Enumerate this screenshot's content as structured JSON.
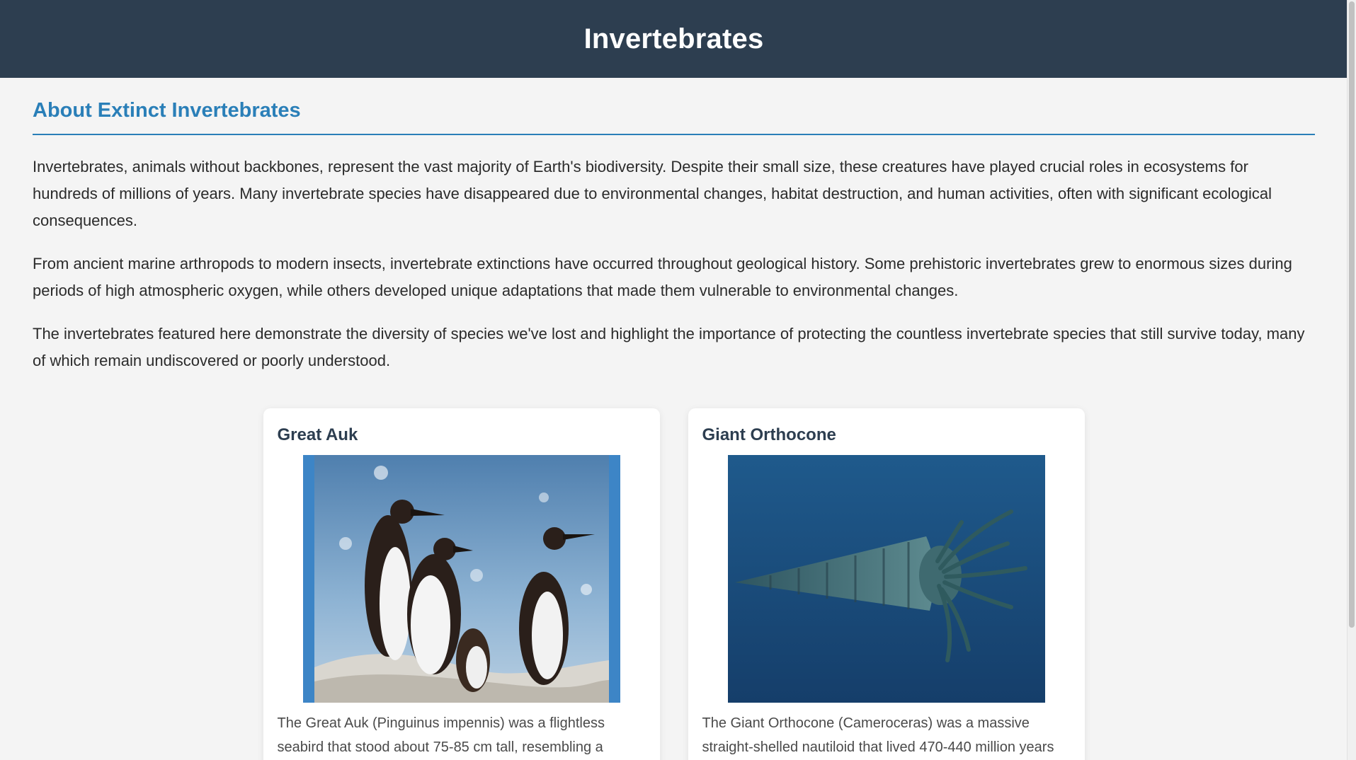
{
  "header": {
    "title": "Invertebrates"
  },
  "about": {
    "title": "About Extinct Invertebrates",
    "paragraphs": [
      "Invertebrates, animals without backbones, represent the vast majority of Earth's biodiversity. Despite their small size, these creatures have played crucial roles in ecosystems for hundreds of millions of years. Many invertebrate species have disappeared due to environmental changes, habitat destruction, and human activities, often with significant ecological consequences.",
      "From ancient marine arthropods to modern insects, invertebrate extinctions have occurred throughout geological history. Some prehistoric invertebrates grew to enormous sizes during periods of high atmospheric oxygen, while others developed unique adaptations that made them vulnerable to environmental changes.",
      "The invertebrates featured here demonstrate the diversity of species we've lost and highlight the importance of protecting the countless invertebrate species that still survive today, many of which remain undiscovered or poorly understood."
    ]
  },
  "cards": [
    {
      "name": "Great Auk",
      "description": "The Great Auk (Pinguinus impennis) was a flightless seabird that stood about 75-85 cm tall, resembling a"
    },
    {
      "name": "Giant Orthocone",
      "description": "The Giant Orthocone (Cameroceras) was a massive straight-shelled nautiloid that lived 470-440 million years"
    }
  ],
  "colors": {
    "header_bg": "#2d3e50",
    "accent": "#2a7fb8",
    "page_bg": "#f4f4f4"
  }
}
